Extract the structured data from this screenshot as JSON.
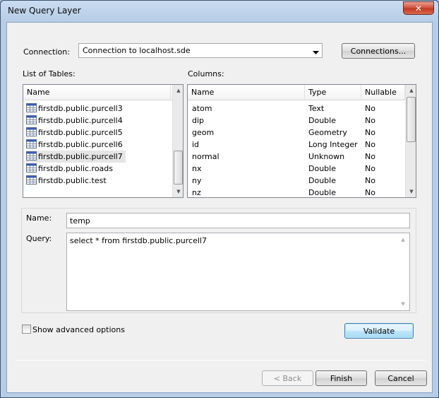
{
  "window": {
    "title": "New Query Layer",
    "close_glyph": "✕"
  },
  "connection": {
    "label": "Connection:",
    "value": "Connection to localhost.sde",
    "connections_button": "Connections..."
  },
  "tables": {
    "label": "List of Tables:",
    "header": "Name",
    "items": [
      "firstdb.public.purcell3",
      "firstdb.public.purcell4",
      "firstdb.public.purcell5",
      "firstdb.public.purcell6",
      "firstdb.public.purcell7",
      "firstdb.public.roads",
      "firstdb.public.test"
    ],
    "selected_index": 4,
    "icon": "table-icon"
  },
  "columns": {
    "label": "Columns:",
    "headers": [
      "Name",
      "Type",
      "Nullable"
    ],
    "rows": [
      [
        "atom",
        "Text",
        "No"
      ],
      [
        "dip",
        "Double",
        "No"
      ],
      [
        "geom",
        "Geometry",
        "No"
      ],
      [
        "id",
        "Long Integer",
        "No"
      ],
      [
        "normal",
        "Unknown",
        "No"
      ],
      [
        "nx",
        "Double",
        "No"
      ],
      [
        "ny",
        "Double",
        "No"
      ],
      [
        "nz",
        "Double",
        "No"
      ]
    ]
  },
  "name_field": {
    "label": "Name:",
    "value": "temp"
  },
  "query_field": {
    "label": "Query:",
    "value": "select * from firstdb.public.purcell7"
  },
  "advanced": {
    "label": "Show advanced options",
    "checked": false
  },
  "buttons": {
    "validate": "Validate",
    "back": "< Back",
    "finish": "Finish",
    "cancel": "Cancel"
  },
  "icons": {
    "dropdown": "chevron-down-icon",
    "scroll_up": "scroll-up-arrow-icon",
    "scroll_down": "scroll-down-arrow-icon"
  }
}
